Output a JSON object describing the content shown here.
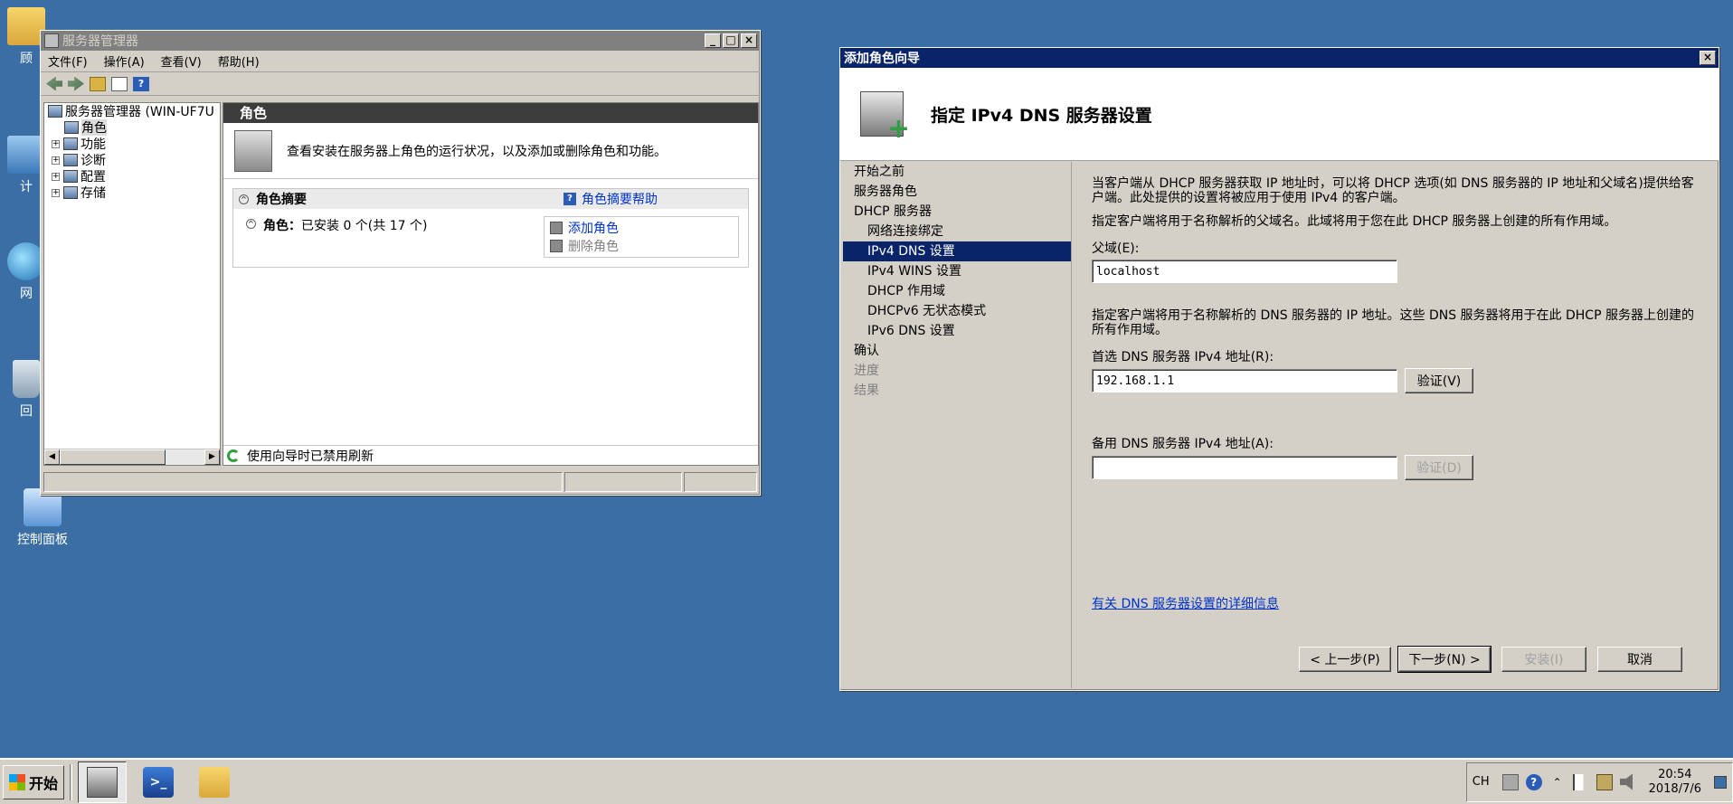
{
  "desktop": {
    "icons": [
      {
        "label": "顾"
      },
      {
        "label": "计"
      },
      {
        "label": "网"
      },
      {
        "label": "回"
      },
      {
        "label": "控制面板"
      }
    ]
  },
  "server_manager": {
    "title": "服务器管理器",
    "menu": [
      "文件(F)",
      "操作(A)",
      "查看(V)",
      "帮助(H)"
    ],
    "tree": {
      "root": "服务器管理器 (WIN-UF7U",
      "items": [
        "角色",
        "功能",
        "诊断",
        "配置",
        "存储"
      ]
    },
    "pane_title": "角色",
    "intro": "查看安装在服务器上角色的运行状况，以及添加或删除角色和功能。",
    "summary_title": "角色摘要",
    "summary_help": "角色摘要帮助",
    "roles_label": "角色：",
    "roles_value": "已安装 0 个(共 17 个)",
    "add_role": "添加角色",
    "remove_role": "删除角色",
    "status": "使用向导时已禁用刷新"
  },
  "wizard": {
    "title": "添加角色向导",
    "heading": "指定 IPv4 DNS 服务器设置",
    "steps": [
      {
        "label": "开始之前",
        "state": "normal"
      },
      {
        "label": "服务器角色",
        "state": "normal"
      },
      {
        "label": "DHCP 服务器",
        "state": "normal"
      },
      {
        "label": "网络连接绑定",
        "state": "sub"
      },
      {
        "label": "IPv4 DNS 设置",
        "state": "current"
      },
      {
        "label": "IPv4 WINS 设置",
        "state": "sub"
      },
      {
        "label": "DHCP 作用域",
        "state": "sub"
      },
      {
        "label": "DHCPv6 无状态模式",
        "state": "sub"
      },
      {
        "label": "IPv6 DNS 设置",
        "state": "sub"
      },
      {
        "label": "确认",
        "state": "normal"
      },
      {
        "label": "进度",
        "state": "dim"
      },
      {
        "label": "结果",
        "state": "dim"
      }
    ],
    "desc1": "当客户端从 DHCP 服务器获取 IP 地址时，可以将 DHCP 选项(如 DNS 服务器的 IP 地址和父域名)提供给客户端。此处提供的设置将被应用于使用 IPv4 的客户端。",
    "desc2": "指定客户端将用于名称解析的父域名。此域将用于您在此 DHCP 服务器上创建的所有作用域。",
    "parent_domain_label": "父域(E):",
    "parent_domain_value": "localhost",
    "desc3": "指定客户端将用于名称解析的 DNS 服务器的 IP 地址。这些 DNS 服务器将用于在此 DHCP 服务器上创建的所有作用域。",
    "preferred_label": "首选 DNS 服务器 IPv4 地址(R):",
    "preferred_value": "192.168.1.1",
    "validate_preferred": "验证(V)",
    "alternate_label": "备用 DNS 服务器 IPv4 地址(A):",
    "alternate_value": "",
    "validate_alternate": "验证(D)",
    "more_info_link": "有关 DNS 服务器设置的详细信息",
    "buttons": {
      "back": "< 上一步(P)",
      "next": "下一步(N) >",
      "install": "安装(I)",
      "cancel": "取消"
    }
  },
  "taskbar": {
    "start": "开始",
    "lang": "CH",
    "time": "20:54",
    "date": "2018/7/6"
  }
}
